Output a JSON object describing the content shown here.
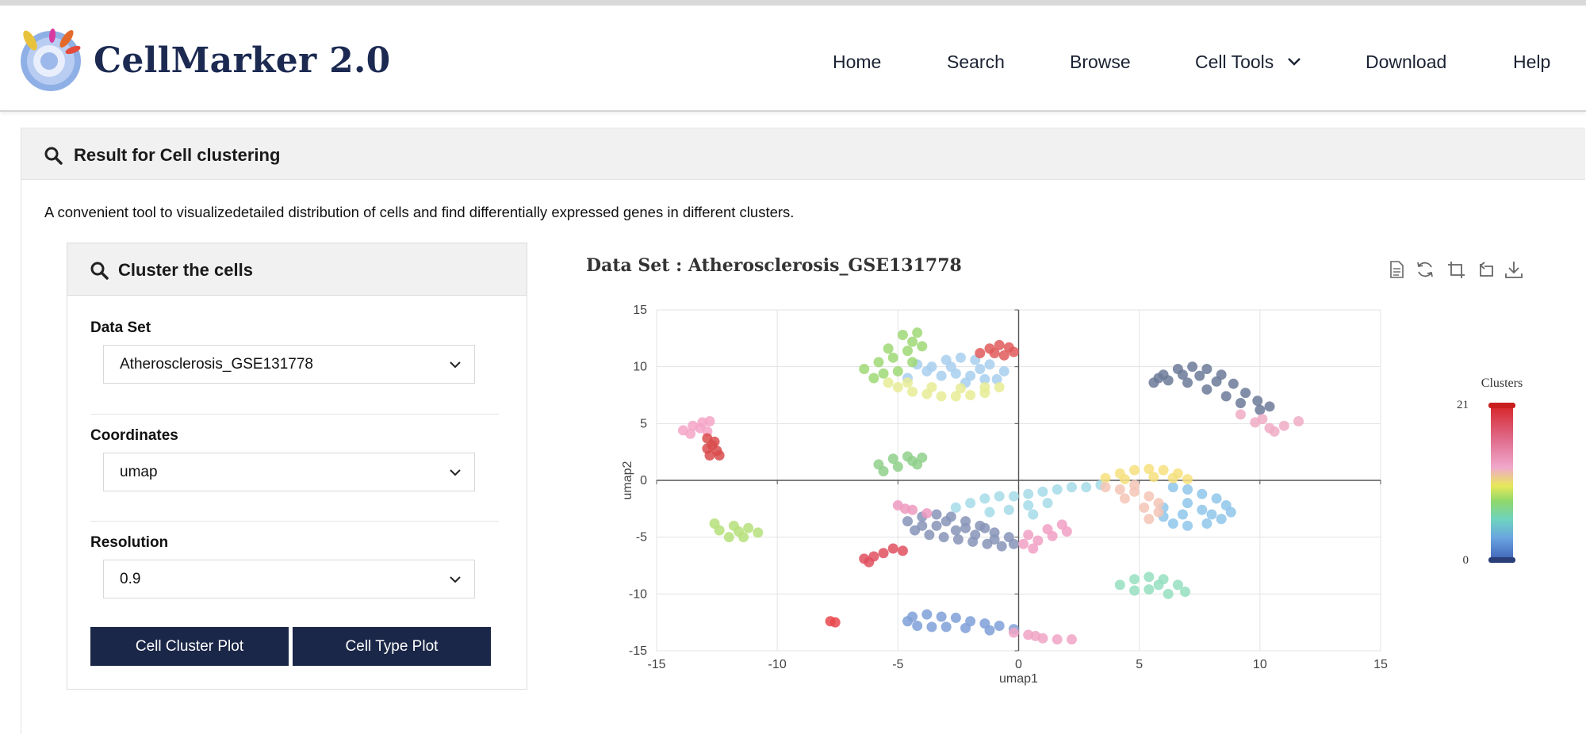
{
  "header": {
    "brand": "CellMarker 2.0",
    "nav": [
      {
        "label": "Home"
      },
      {
        "label": "Search"
      },
      {
        "label": "Browse"
      },
      {
        "label": "Cell Tools"
      },
      {
        "label": "Download"
      },
      {
        "label": "Help"
      }
    ]
  },
  "panel": {
    "title": "Result for Cell clustering",
    "intro": "A convenient tool to visualizedetailed distribution of cells and find differentially expressed genes in different clusters."
  },
  "form": {
    "title": "Cluster the cells",
    "dataset_label": "Data Set",
    "dataset_value": "Atherosclerosis_GSE131778",
    "coordinates_label": "Coordinates",
    "coordinates_value": "umap",
    "resolution_label": "Resolution",
    "resolution_value": "0.9",
    "cluster_plot_button": "Cell Cluster Plot",
    "cell_type_plot_button": "Cell Type Plot"
  },
  "toolbox": [
    "data-view-icon",
    "restore-icon",
    "zoom-icon",
    "zoom-reset-icon",
    "download-icon"
  ],
  "chart_data": {
    "type": "scatter",
    "title": "Data Set : Atherosclerosis_GSE131778",
    "xlabel": "umap1",
    "ylabel": "umap2",
    "xlim": [
      -15,
      15
    ],
    "ylim": [
      -15,
      15
    ],
    "xticks": [
      "-15",
      "-10",
      "-5",
      "0",
      "5",
      "10",
      "15"
    ],
    "yticks": [
      "15",
      "10",
      "5",
      "0",
      "-5",
      "-10",
      "-15"
    ],
    "grid": true,
    "legend": {
      "title": "Clusters",
      "min": "0",
      "max": "21",
      "placement": "right"
    },
    "clusters": [
      {
        "id": 0,
        "color": "#8794b8",
        "points": [
          [
            -4.6,
            -3.6
          ],
          [
            -4.0,
            -3.2
          ],
          [
            -3.4,
            -3.0
          ],
          [
            -2.8,
            -3.2
          ],
          [
            -2.2,
            -3.6
          ],
          [
            -1.6,
            -4.0
          ],
          [
            -1.0,
            -4.6
          ],
          [
            -0.4,
            -5.0
          ],
          [
            -4.3,
            -4.4
          ],
          [
            -3.7,
            -4.8
          ],
          [
            -3.1,
            -5.0
          ],
          [
            -2.5,
            -5.2
          ],
          [
            -1.9,
            -5.4
          ],
          [
            -1.3,
            -5.6
          ],
          [
            -0.7,
            -5.8
          ],
          [
            -3.4,
            -4.0
          ],
          [
            -2.6,
            -4.4
          ],
          [
            -1.8,
            -4.8
          ],
          [
            -1.0,
            -5.2
          ],
          [
            -4.0,
            -4.0
          ],
          [
            -2.2,
            -4.2
          ],
          [
            -0.2,
            -5.6
          ],
          [
            -3.0,
            -3.6
          ],
          [
            -1.4,
            -4.2
          ]
        ]
      },
      {
        "id": 1,
        "color": "#6c7a99",
        "points": [
          [
            5.6,
            8.6
          ],
          [
            6.0,
            9.3
          ],
          [
            6.6,
            9.8
          ],
          [
            7.2,
            10.0
          ],
          [
            7.8,
            9.8
          ],
          [
            8.4,
            9.3
          ],
          [
            8.9,
            8.5
          ],
          [
            9.4,
            7.7
          ],
          [
            9.9,
            7.0
          ],
          [
            10.4,
            6.5
          ],
          [
            6.2,
            8.8
          ],
          [
            7.0,
            8.6
          ],
          [
            7.8,
            8.0
          ],
          [
            8.6,
            7.4
          ],
          [
            9.2,
            6.8
          ],
          [
            6.8,
            9.3
          ],
          [
            7.5,
            9.2
          ],
          [
            8.2,
            8.7
          ],
          [
            5.8,
            9.0
          ],
          [
            10.0,
            6.2
          ]
        ]
      },
      {
        "id": 2,
        "color": "#a8cfee",
        "points": [
          [
            -3.6,
            10.0
          ],
          [
            -3.0,
            10.6
          ],
          [
            -2.4,
            10.8
          ],
          [
            -1.8,
            10.6
          ],
          [
            -1.2,
            10.2
          ],
          [
            -0.6,
            9.6
          ],
          [
            -3.2,
            9.2
          ],
          [
            -2.6,
            9.4
          ],
          [
            -2.0,
            9.2
          ],
          [
            -1.4,
            8.9
          ],
          [
            -0.9,
            8.9
          ],
          [
            -3.8,
            9.6
          ],
          [
            -2.8,
            10.0
          ],
          [
            -1.6,
            9.8
          ],
          [
            -2.2,
            8.6
          ],
          [
            -4.2,
            10.2
          ],
          [
            -4.6,
            9.0
          ]
        ]
      },
      {
        "id": 3,
        "color": "#e6ec95",
        "points": [
          [
            -5.0,
            8.2
          ],
          [
            -4.4,
            7.8
          ],
          [
            -3.8,
            7.6
          ],
          [
            -3.2,
            7.4
          ],
          [
            -2.6,
            7.4
          ],
          [
            -2.0,
            7.5
          ],
          [
            -1.4,
            7.7
          ],
          [
            -0.8,
            8.2
          ],
          [
            -4.6,
            8.6
          ],
          [
            -3.6,
            8.2
          ],
          [
            -2.4,
            8.1
          ],
          [
            -1.4,
            8.2
          ],
          [
            -5.4,
            8.6
          ]
        ]
      },
      {
        "id": 4,
        "color": "#9fd876",
        "points": [
          [
            -6.4,
            9.8
          ],
          [
            -5.8,
            10.4
          ],
          [
            -5.2,
            10.8
          ],
          [
            -4.6,
            11.4
          ],
          [
            -4.4,
            12.2
          ],
          [
            -4.8,
            12.8
          ],
          [
            -5.6,
            9.4
          ],
          [
            -6.0,
            9.0
          ],
          [
            -5.0,
            9.6
          ],
          [
            -4.4,
            10.4
          ],
          [
            -4.0,
            11.8
          ],
          [
            -5.4,
            11.6
          ],
          [
            -4.2,
            13.0
          ]
        ]
      },
      {
        "id": 5,
        "color": "#e05a5a",
        "points": [
          [
            -1.6,
            11.2
          ],
          [
            -1.2,
            11.6
          ],
          [
            -0.8,
            11.9
          ],
          [
            -0.4,
            11.7
          ],
          [
            -0.2,
            11.3
          ],
          [
            -0.6,
            11.0
          ],
          [
            -1.0,
            11.2
          ]
        ]
      },
      {
        "id": 6,
        "color": "#a4dbe8",
        "points": [
          [
            -2.6,
            -2.4
          ],
          [
            -2.0,
            -2.0
          ],
          [
            -1.4,
            -1.6
          ],
          [
            -0.8,
            -1.4
          ],
          [
            -0.2,
            -1.4
          ],
          [
            0.4,
            -1.2
          ],
          [
            1.0,
            -1.0
          ],
          [
            1.6,
            -0.8
          ],
          [
            2.2,
            -0.6
          ],
          [
            2.8,
            -0.6
          ],
          [
            3.4,
            -0.4
          ],
          [
            -0.4,
            -2.6
          ],
          [
            0.4,
            -2.2
          ],
          [
            1.2,
            -2.0
          ],
          [
            0.6,
            -3.0
          ],
          [
            -1.2,
            -2.8
          ]
        ]
      },
      {
        "id": 7,
        "color": "#8fc6ea",
        "points": [
          [
            6.4,
            -0.6
          ],
          [
            7.0,
            -0.8
          ],
          [
            7.6,
            -1.2
          ],
          [
            8.2,
            -1.6
          ],
          [
            8.6,
            -2.2
          ],
          [
            8.8,
            -2.8
          ],
          [
            8.4,
            -3.4
          ],
          [
            7.8,
            -3.8
          ],
          [
            7.0,
            -4.0
          ],
          [
            6.4,
            -3.8
          ],
          [
            6.0,
            -3.2
          ],
          [
            6.0,
            -2.4
          ],
          [
            7.0,
            -2.0
          ],
          [
            7.6,
            -2.6
          ],
          [
            6.8,
            -3.0
          ],
          [
            8.0,
            -3.0
          ]
        ]
      },
      {
        "id": 8,
        "color": "#f6e07e",
        "points": [
          [
            3.6,
            0.2
          ],
          [
            4.2,
            0.6
          ],
          [
            4.8,
            0.9
          ],
          [
            5.4,
            1.0
          ],
          [
            6.0,
            0.9
          ],
          [
            6.6,
            0.6
          ],
          [
            7.0,
            0.1
          ],
          [
            4.4,
            0.1
          ],
          [
            5.6,
            0.3
          ],
          [
            6.4,
            0.2
          ]
        ]
      },
      {
        "id": 9,
        "color": "#f5c6b6",
        "points": [
          [
            3.6,
            -0.6
          ],
          [
            4.2,
            -0.8
          ],
          [
            4.8,
            -1.0
          ],
          [
            5.4,
            -1.4
          ],
          [
            5.8,
            -2.0
          ],
          [
            5.8,
            -2.8
          ],
          [
            5.4,
            -3.4
          ],
          [
            4.8,
            -0.4
          ],
          [
            5.2,
            -2.4
          ],
          [
            4.4,
            -1.6
          ]
        ]
      },
      {
        "id": 10,
        "color": "#95dfc0",
        "points": [
          [
            4.2,
            -9.2
          ],
          [
            4.8,
            -8.7
          ],
          [
            5.4,
            -8.5
          ],
          [
            6.0,
            -8.7
          ],
          [
            6.6,
            -9.2
          ],
          [
            6.9,
            -9.8
          ],
          [
            6.2,
            -10.0
          ],
          [
            5.4,
            -9.6
          ],
          [
            4.8,
            -9.7
          ],
          [
            5.8,
            -9.2
          ]
        ]
      },
      {
        "id": 11,
        "color": "#7fa0d8",
        "points": [
          [
            -4.4,
            -12.0
          ],
          [
            -3.8,
            -11.8
          ],
          [
            -3.2,
            -12.0
          ],
          [
            -2.6,
            -12.1
          ],
          [
            -2.0,
            -12.4
          ],
          [
            -1.4,
            -12.6
          ],
          [
            -0.8,
            -12.8
          ],
          [
            -0.2,
            -13.1
          ],
          [
            -4.2,
            -12.8
          ],
          [
            -3.6,
            -12.9
          ],
          [
            -3.0,
            -12.9
          ],
          [
            -2.2,
            -13.0
          ],
          [
            -1.2,
            -13.2
          ],
          [
            -4.6,
            -12.4
          ]
        ]
      },
      {
        "id": 12,
        "color": "#f0a5c4",
        "points": [
          [
            -0.2,
            -13.4
          ],
          [
            0.4,
            -13.6
          ],
          [
            1.0,
            -13.9
          ],
          [
            1.6,
            -14.0
          ],
          [
            2.2,
            -14.0
          ],
          [
            0.7,
            -13.7
          ]
        ]
      },
      {
        "id": 13,
        "color": "#f4a5c7",
        "points": [
          [
            -13.9,
            4.4
          ],
          [
            -13.5,
            4.8
          ],
          [
            -13.1,
            5.1
          ],
          [
            -12.8,
            5.2
          ],
          [
            -13.6,
            4.1
          ],
          [
            -13.2,
            4.6
          ],
          [
            -12.9,
            4.3
          ]
        ]
      },
      {
        "id": 14,
        "color": "#d94c4c",
        "points": [
          [
            -12.9,
            3.7
          ],
          [
            -12.7,
            3.1
          ],
          [
            -12.5,
            2.6
          ],
          [
            -12.8,
            2.2
          ],
          [
            -12.4,
            2.2
          ],
          [
            -12.6,
            3.4
          ],
          [
            -12.9,
            2.8
          ]
        ]
      },
      {
        "id": 15,
        "color": "#8fd08b",
        "points": [
          [
            -5.8,
            1.4
          ],
          [
            -5.2,
            1.9
          ],
          [
            -4.6,
            2.1
          ],
          [
            -4.0,
            2.0
          ],
          [
            -4.2,
            1.4
          ],
          [
            -5.0,
            1.2
          ],
          [
            -5.6,
            0.8
          ],
          [
            -4.4,
            1.7
          ]
        ]
      },
      {
        "id": 16,
        "color": "#b5e07a",
        "points": [
          [
            -12.4,
            -4.4
          ],
          [
            -11.8,
            -4.0
          ],
          [
            -11.2,
            -4.2
          ],
          [
            -10.8,
            -4.6
          ],
          [
            -11.4,
            -5.0
          ],
          [
            -12.0,
            -5.0
          ],
          [
            -11.6,
            -4.5
          ],
          [
            -12.6,
            -3.8
          ]
        ]
      },
      {
        "id": 17,
        "color": "#ef9ac0",
        "points": [
          [
            -5.0,
            -2.2
          ],
          [
            -4.4,
            -2.6
          ],
          [
            -3.8,
            -2.9
          ],
          [
            -4.7,
            -2.5
          ]
        ]
      },
      {
        "id": 18,
        "color": "#f2a0c4",
        "points": [
          [
            0.2,
            -5.6
          ],
          [
            0.8,
            -5.3
          ],
          [
            1.4,
            -4.9
          ],
          [
            2.0,
            -4.5
          ],
          [
            0.4,
            -4.8
          ],
          [
            1.2,
            -4.3
          ],
          [
            0.6,
            -6.0
          ],
          [
            1.8,
            -3.9
          ]
        ]
      },
      {
        "id": 19,
        "color": "#f0acc6",
        "points": [
          [
            9.2,
            5.8
          ],
          [
            9.8,
            5.1
          ],
          [
            10.4,
            4.6
          ],
          [
            11.0,
            4.8
          ],
          [
            11.6,
            5.2
          ],
          [
            10.6,
            4.3
          ],
          [
            10.1,
            5.4
          ]
        ]
      },
      {
        "id": 20,
        "color": "#e05060",
        "points": [
          [
            -6.4,
            -6.9
          ],
          [
            -6.0,
            -6.7
          ],
          [
            -5.6,
            -6.4
          ],
          [
            -6.2,
            -7.2
          ],
          [
            -5.2,
            -6.0
          ],
          [
            -4.8,
            -6.2
          ]
        ]
      },
      {
        "id": 21,
        "color": "#e8484e",
        "points": [
          [
            -7.8,
            -12.4
          ],
          [
            -7.6,
            -12.5
          ]
        ]
      }
    ]
  }
}
